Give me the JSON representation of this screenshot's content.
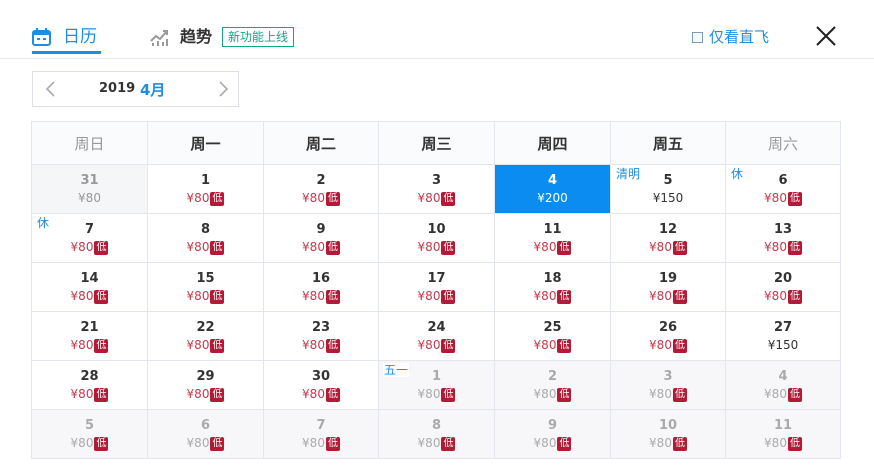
{
  "header": {
    "tab_calendar": "日历",
    "tab_trend": "趋势",
    "new_badge": "新功能上线",
    "direct_only": "仅看直飞"
  },
  "picker": {
    "year": "2019",
    "month": "4月"
  },
  "weekdays": [
    "周日",
    "周一",
    "周二",
    "周三",
    "周四",
    "周五",
    "周六"
  ],
  "colors": {
    "accent": "#1d8ee6",
    "selected_bg": "#0a8cf0",
    "price": "#c43a4d",
    "low_badge": "#b21a36",
    "badge_green": "#13a58a"
  },
  "low_label": "低",
  "weeks": [
    [
      {
        "day": "31",
        "price": "¥80",
        "low": false,
        "state": "grey"
      },
      {
        "day": "1",
        "price": "¥80",
        "low": true
      },
      {
        "day": "2",
        "price": "¥80",
        "low": true
      },
      {
        "day": "3",
        "price": "¥80",
        "low": true
      },
      {
        "day": "4",
        "price": "¥200",
        "low": false,
        "state": "selected"
      },
      {
        "day": "5",
        "price": "¥150",
        "low": false,
        "tag": "清明"
      },
      {
        "day": "6",
        "price": "¥80",
        "low": true,
        "tag": "休"
      }
    ],
    [
      {
        "day": "7",
        "price": "¥80",
        "low": true,
        "tag": "休"
      },
      {
        "day": "8",
        "price": "¥80",
        "low": true
      },
      {
        "day": "9",
        "price": "¥80",
        "low": true
      },
      {
        "day": "10",
        "price": "¥80",
        "low": true
      },
      {
        "day": "11",
        "price": "¥80",
        "low": true
      },
      {
        "day": "12",
        "price": "¥80",
        "low": true
      },
      {
        "day": "13",
        "price": "¥80",
        "low": true
      }
    ],
    [
      {
        "day": "14",
        "price": "¥80",
        "low": true
      },
      {
        "day": "15",
        "price": "¥80",
        "low": true
      },
      {
        "day": "16",
        "price": "¥80",
        "low": true
      },
      {
        "day": "17",
        "price": "¥80",
        "low": true
      },
      {
        "day": "18",
        "price": "¥80",
        "low": true
      },
      {
        "day": "19",
        "price": "¥80",
        "low": true
      },
      {
        "day": "20",
        "price": "¥80",
        "low": true
      }
    ],
    [
      {
        "day": "21",
        "price": "¥80",
        "low": true
      },
      {
        "day": "22",
        "price": "¥80",
        "low": true
      },
      {
        "day": "23",
        "price": "¥80",
        "low": true
      },
      {
        "day": "24",
        "price": "¥80",
        "low": true
      },
      {
        "day": "25",
        "price": "¥80",
        "low": true
      },
      {
        "day": "26",
        "price": "¥80",
        "low": true
      },
      {
        "day": "27",
        "price": "¥150",
        "low": false
      }
    ],
    [
      {
        "day": "28",
        "price": "¥80",
        "low": true
      },
      {
        "day": "29",
        "price": "¥80",
        "low": true
      },
      {
        "day": "30",
        "price": "¥80",
        "low": true
      },
      {
        "day": "1",
        "price": "¥80",
        "low": true,
        "state": "out",
        "tag": "五一"
      },
      {
        "day": "2",
        "price": "¥80",
        "low": true,
        "state": "out"
      },
      {
        "day": "3",
        "price": "¥80",
        "low": true,
        "state": "out"
      },
      {
        "day": "4",
        "price": "¥80",
        "low": true,
        "state": "out"
      }
    ],
    [
      {
        "day": "5",
        "price": "¥80",
        "low": true,
        "state": "out"
      },
      {
        "day": "6",
        "price": "¥80",
        "low": true,
        "state": "out"
      },
      {
        "day": "7",
        "price": "¥80",
        "low": true,
        "state": "out"
      },
      {
        "day": "8",
        "price": "¥80",
        "low": true,
        "state": "out"
      },
      {
        "day": "9",
        "price": "¥80",
        "low": true,
        "state": "out"
      },
      {
        "day": "10",
        "price": "¥80",
        "low": true,
        "state": "out"
      },
      {
        "day": "11",
        "price": "¥80",
        "low": true,
        "state": "out"
      }
    ]
  ]
}
